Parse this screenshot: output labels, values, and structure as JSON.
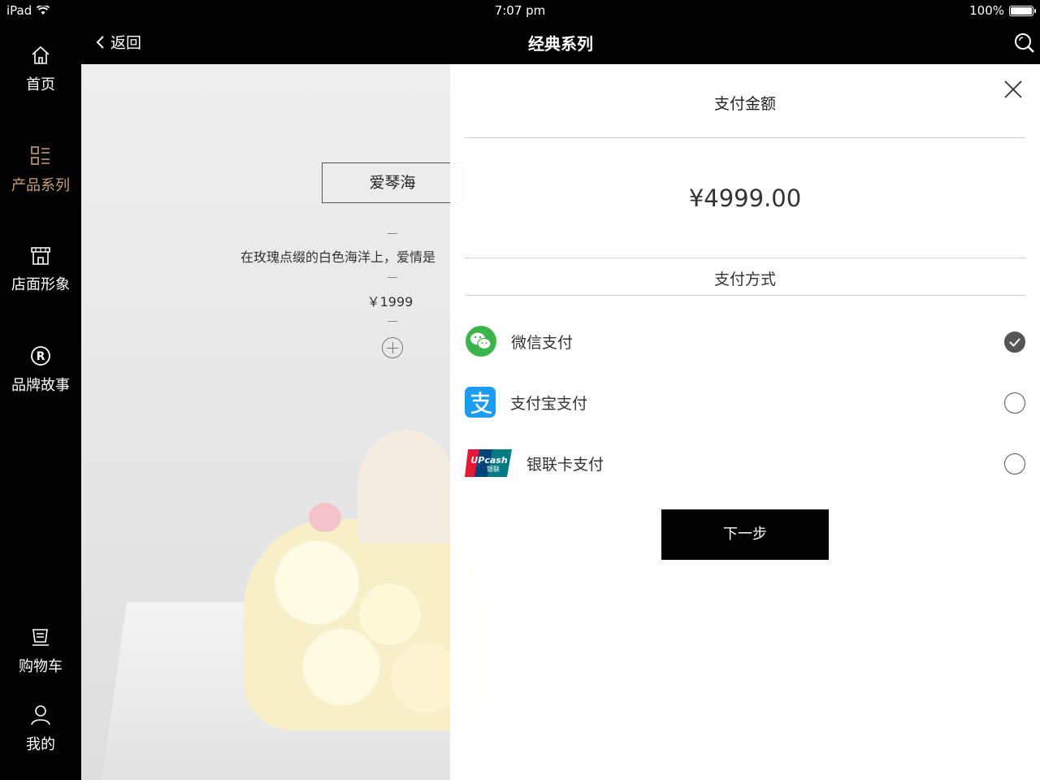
{
  "status_bar": {
    "device": "iPad",
    "time": "7:07 pm",
    "battery": "100%"
  },
  "header": {
    "back_label": "返回",
    "title": "经典系列"
  },
  "sidebar": {
    "items": [
      {
        "label": "首页",
        "icon": "home-icon"
      },
      {
        "label": "产品系列",
        "icon": "product-grid-icon",
        "active": true
      },
      {
        "label": "店面形象",
        "icon": "store-icon"
      },
      {
        "label": "品牌故事",
        "icon": "registered-trademark-icon"
      }
    ],
    "bottom_items": [
      {
        "label": "购物车",
        "icon": "cart-icon"
      },
      {
        "label": "我的",
        "icon": "user-icon"
      }
    ],
    "active_color": "#c8a071"
  },
  "product": {
    "name": "爱琴海",
    "description": "在玫瑰点缀的白色海洋上，爱情是",
    "price": "￥1999"
  },
  "payment": {
    "title": "支付金额",
    "amount": "¥4999.00",
    "method_label": "支付方式",
    "options": [
      {
        "label": "微信支付",
        "icon": "wechat-pay-icon",
        "selected": true,
        "color": "#3bb54a"
      },
      {
        "label": "支付宝支付",
        "icon": "alipay-icon",
        "selected": false,
        "color": "#1a9df0"
      },
      {
        "label": "银联卡支付",
        "icon": "unionpay-icon",
        "selected": false,
        "logo_text": "UPcash 银联"
      }
    ],
    "next_label": "下一步"
  }
}
